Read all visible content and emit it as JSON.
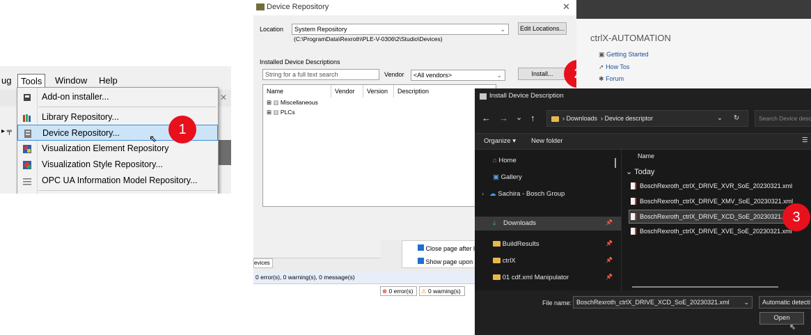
{
  "panel1": {
    "menubar": [
      "ug",
      "Tools",
      "Window",
      "Help"
    ],
    "menu_items": [
      {
        "label": "Add-on installer...",
        "icon": "installer-icon"
      },
      {
        "label": "Library Repository...",
        "icon": "books-icon"
      },
      {
        "label": "Device Repository...",
        "icon": "device-repository-icon"
      },
      {
        "label": "Visualization Element Repository",
        "icon": "visualization-element-icon"
      },
      {
        "label": "Visualization Style Repository...",
        "icon": "visualization-style-icon"
      },
      {
        "label": "OPC UA Information Model Repository...",
        "icon": "opc-ua-icon"
      }
    ],
    "badge": "1"
  },
  "panel2": {
    "title": "Device Repository",
    "location_label": "Location",
    "location_value": "System Repository",
    "location_path": "(C:\\ProgramData\\Rexroth\\PLE-V-0306\\2\\Studio\\Devices)",
    "edit_locations": "Edit Locations...",
    "installed_label": "Installed Device Descriptions",
    "search_placeholder": "String for a full text search",
    "vendor_label": "Vendor",
    "vendor_value": "<All vendors>",
    "install_button": "Install...",
    "columns": [
      "Name",
      "Vendor",
      "Version",
      "Description"
    ],
    "tree": [
      "Miscellaneous",
      "PLCs"
    ],
    "badge": "2",
    "close_page_after": "Close page after lo",
    "show_page_upon": "Show page upon s",
    "devices_tab": "evices",
    "messages": "0 error(s), 0 warning(s), 0 message(s)",
    "status_errors": "0 error(s)",
    "status_warnings": "0 warning(s)"
  },
  "welcome": {
    "title": "ctrlX-AUTOMATION",
    "links": [
      "Getting Started",
      "How Tos",
      "Forum"
    ]
  },
  "panel3": {
    "title": "Install Device Description",
    "breadcrumb": [
      "Downloads",
      "Device descriptor"
    ],
    "search_placeholder": "Search Device desc",
    "organize": "Organize",
    "new_folder": "New folder",
    "nav_items": [
      {
        "label": "Home",
        "icon": "home-icon"
      },
      {
        "label": "Gallery",
        "icon": "gallery-icon"
      },
      {
        "label": "Sachira - Bosch Group",
        "icon": "cloud-icon"
      },
      {
        "label": "Downloads",
        "icon": "download-icon"
      },
      {
        "label": "BuildResults",
        "icon": "folder-icon"
      },
      {
        "label": "ctrlX",
        "icon": "folder-icon"
      },
      {
        "label": "01 cdf.xml Manipulator",
        "icon": "folder-icon"
      }
    ],
    "column_name": "Name",
    "group": "Today",
    "files": [
      "BoschRexroth_ctrlX_DRIVE_XVR_SoE_20230321.xml",
      "BoschRexroth_ctrlX_DRIVE_XMV_SoE_20230321.xml",
      "BoschRexroth_ctrlX_DRIVE_XCD_SoE_20230321.xml",
      "BoschRexroth_ctrlX_DRIVE_XVE_SoE_20230321.xml"
    ],
    "filename_label": "File name:",
    "filename_value": "BoschRexroth_ctrlX_DRIVE_XCD_SoE_20230321.xml",
    "filter_value": "Automatic detecti",
    "open_button": "Open",
    "badge": "3"
  }
}
